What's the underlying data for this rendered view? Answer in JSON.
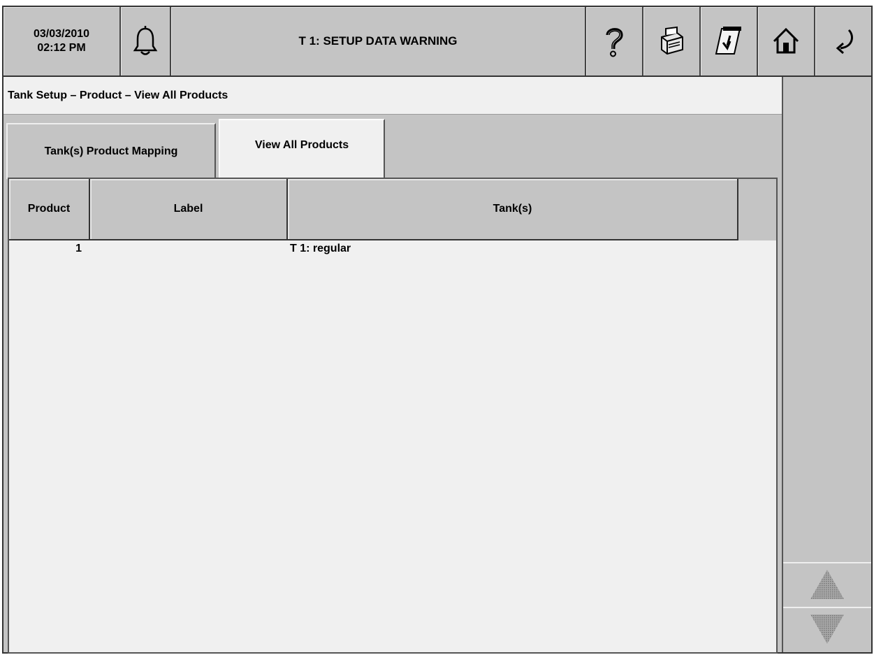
{
  "header": {
    "date": "03/03/2010",
    "time": "02:12 PM",
    "title": "T 1: SETUP DATA WARNING",
    "icons": [
      "bell-icon",
      "help-icon",
      "printer-icon",
      "paper-feed-icon",
      "home-icon",
      "back-arrow-icon"
    ]
  },
  "breadcrumb": "Tank Setup  –  Product  –  View All Products",
  "tabs": [
    {
      "label": "Tank(s) Product Mapping",
      "active": false
    },
    {
      "label": "View All Products",
      "active": true
    }
  ],
  "table": {
    "columns": [
      "Product",
      "Label",
      "Tank(s)"
    ],
    "rows": [
      {
        "product": "1",
        "label": "",
        "tanks": "T  1: regular"
      }
    ]
  },
  "scroll": {
    "up_icon": "triangle-up-icon",
    "down_icon": "triangle-down-icon"
  },
  "colors": {
    "panel_gray": "#c4c4c4",
    "content_bg": "#f0f0f0",
    "border": "#333333"
  }
}
